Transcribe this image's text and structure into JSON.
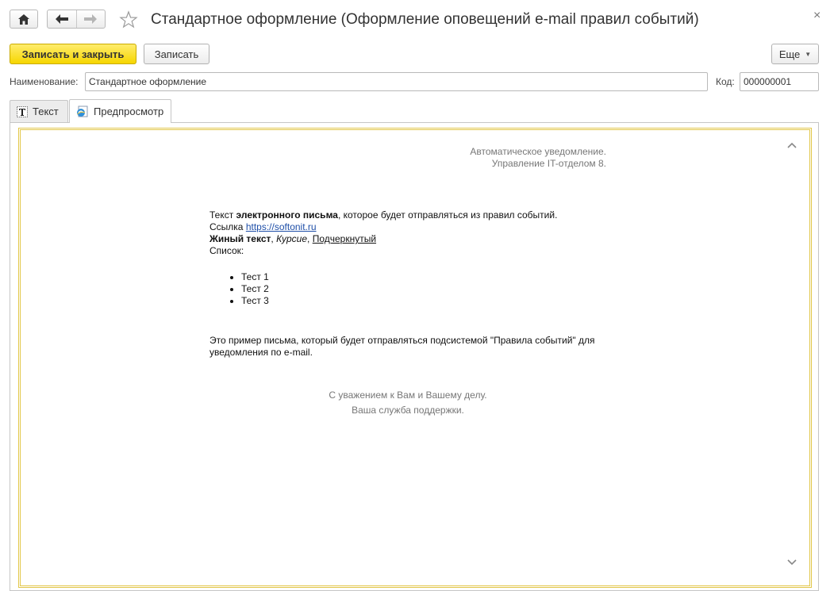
{
  "window": {
    "title": "Стандартное оформление (Оформление оповещений e-mail правил событий)"
  },
  "toolbar": {
    "save_close_label": "Записать и закрыть",
    "save_label": "Записать",
    "more_label": "Еще"
  },
  "form": {
    "name_label": "Наименование:",
    "name_value": "Стандартное оформление",
    "code_label": "Код:",
    "code_value": "000000001"
  },
  "tabs": [
    {
      "label": "Текст",
      "icon": "text-format-icon",
      "active": false
    },
    {
      "label": "Предпросмотр",
      "icon": "browser-preview-icon",
      "active": true
    }
  ],
  "preview": {
    "notice_line1": "Автоматическое уведомление.",
    "notice_line2": "Управление IT-отделом 8.",
    "text_prefix": "Текст ",
    "text_bold": "электронного письма",
    "text_suffix": ", которое будет отправляться из правил событий.",
    "link_label": "Ссылка ",
    "link_text": "https://softonit.ru",
    "bold_sample": "Жиный текст",
    "sep1": ", ",
    "italic_sample": "Курсие",
    "sep2": ", ",
    "underline_sample": "Подчеркнутый",
    "list_label": "Список:",
    "list_items": [
      "Тест 1",
      "Тест 2",
      "Тест 3"
    ],
    "example_text": "Это пример письма, который будет отправляться подсистемой \"Правила событий\" для уведомления по e-mail.",
    "regards_line1": "С уважением к Вам и Вашему делу.",
    "regards_line2": "Ваша служба поддержки."
  },
  "colors": {
    "primary_button": "#f6d600",
    "frame_border": "#e2c74a",
    "link": "#1f4fa8"
  }
}
